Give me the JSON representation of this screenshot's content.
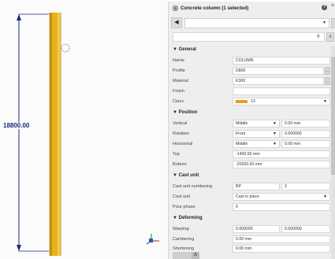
{
  "viewport": {
    "dimension_label": "18800.00"
  },
  "panel": {
    "title": "Concrete column (1 selected)",
    "help_label": "?",
    "close_label": "×",
    "nav_arrow": "◀",
    "menu_glyph": "≡",
    "selected_type": "",
    "search_value": "",
    "sections": {
      "general": "General",
      "position": "Position",
      "cast_unit": "Cast unit",
      "deforming": "Deforming"
    },
    "general": {
      "name_label": "Name",
      "name_value": "COLUMN",
      "profile_label": "Profile",
      "profile_value": "D800",
      "material_label": "Material",
      "material_value": "K300",
      "finish_label": "Finish",
      "finish_value": "",
      "class_label": "Class",
      "class_value": "13"
    },
    "position": {
      "vertical_label": "Vertical",
      "vertical_select": "Middle",
      "vertical_value": "0.00 mm",
      "rotation_label": "Rotation",
      "rotation_select": "Front",
      "rotation_value": "0.000000",
      "horizontal_label": "Horizontal",
      "horizontal_select": "Middle",
      "horizontal_value": "0.00 mm",
      "top_label": "Top",
      "top_value": "-1400.60 mm",
      "bottom_label": "Bottom",
      "bottom_value": "-20200.60 mm"
    },
    "cast_unit": {
      "numbering_label": "Cast unit numbering",
      "prefix_value": "BP",
      "start_value": "2",
      "cast_unit_label": "Cast unit",
      "cast_unit_value": "Cast in place",
      "pour_phase_label": "Pour phase",
      "pour_phase_value": "0"
    },
    "deforming": {
      "warping_label": "Warping",
      "warping_value_1": "0.000000",
      "warping_value_2": "0.000000",
      "cambering_label": "Cambering",
      "cambering_value": "0.00 mm",
      "shortening_label": "Shortening",
      "shortening_value": "0.00 mm"
    },
    "bottom_bar_glyph": "A"
  },
  "colors": {
    "column": "#e8b21e",
    "column_dark": "#b98612",
    "dimension": "#1b2a7a",
    "class_swatch": "#e2a020",
    "handle": "#e0407a"
  }
}
